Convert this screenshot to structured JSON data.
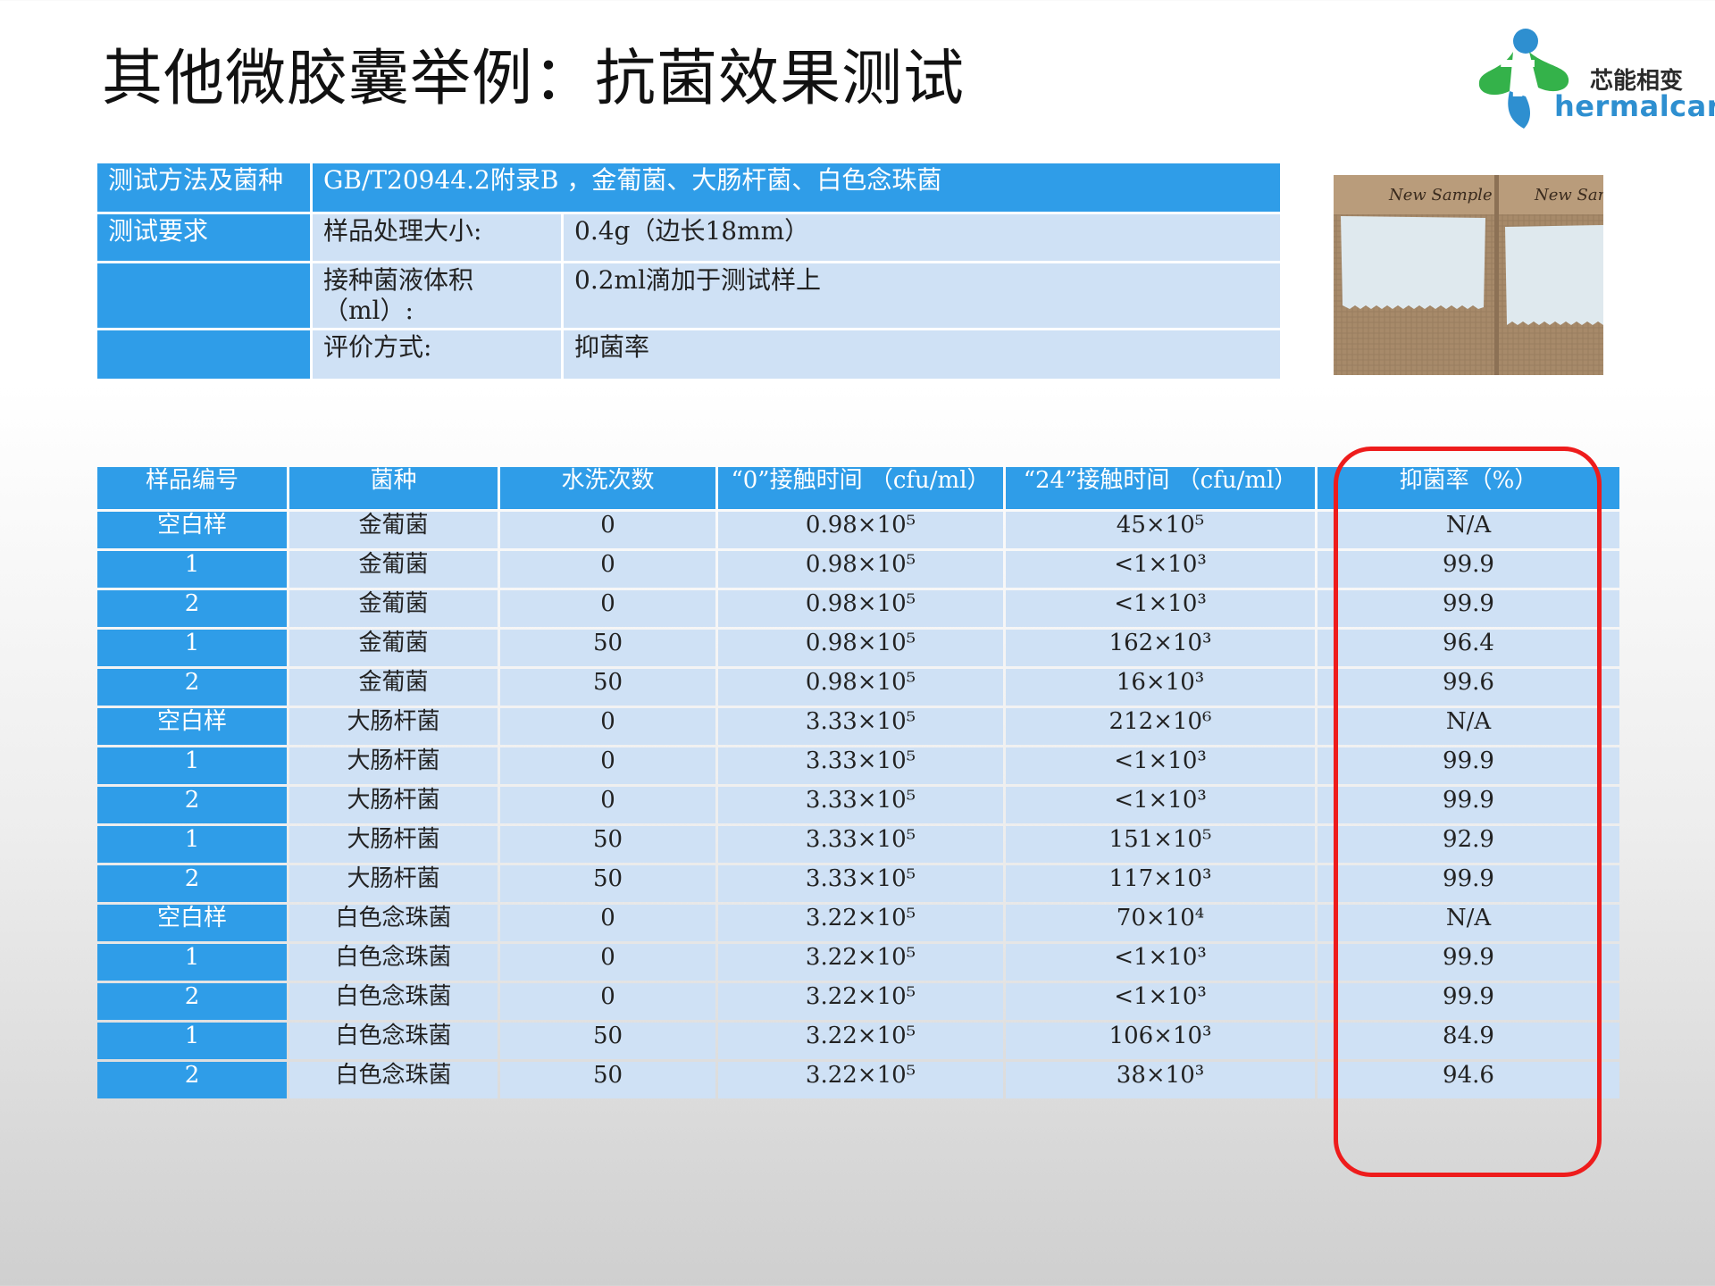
{
  "title": "其他微胶囊举例：抗菌效果测试",
  "logo": {
    "cn": "芯能相变",
    "en": "hermalcare",
    "letter": "T"
  },
  "method": {
    "row1": {
      "label": "测试方法及菌种",
      "value": "GB/T20944.2附录B ，金葡菌、大肠杆菌、白色念珠菌"
    },
    "row2": {
      "label": "测试要求",
      "key": "样品处理大小:",
      "value": "0.4g（边长18mm）"
    },
    "row3": {
      "key": "接种菌液体积（ml）:",
      "value": "0.2ml滴加于测试样上"
    },
    "row4": {
      "key": "评价方式:",
      "value": "抑菌率"
    }
  },
  "photo": {
    "label": "New Sample"
  },
  "results": {
    "headers": [
      "样品编号",
      "菌种",
      "水洗次数",
      "“0”接触时间 （cfu/ml）",
      "“24”接触时间 （cfu/ml）",
      "抑菌率（%）"
    ],
    "rows": [
      [
        "空白样",
        "金葡菌",
        "0",
        "0.98×10⁵",
        "45×10⁵",
        "N/A"
      ],
      [
        "1",
        "金葡菌",
        "0",
        "0.98×10⁵",
        "<1×10³",
        "99.9"
      ],
      [
        "2",
        "金葡菌",
        "0",
        "0.98×10⁵",
        "<1×10³",
        "99.9"
      ],
      [
        "1",
        "金葡菌",
        "50",
        "0.98×10⁵",
        "162×10³",
        "96.4"
      ],
      [
        "2",
        "金葡菌",
        "50",
        "0.98×10⁵",
        "16×10³",
        "99.6"
      ],
      [
        "空白样",
        "大肠杆菌",
        "0",
        "3.33×10⁵",
        "212×10⁶",
        "N/A"
      ],
      [
        "1",
        "大肠杆菌",
        "0",
        "3.33×10⁵",
        "<1×10³",
        "99.9"
      ],
      [
        "2",
        "大肠杆菌",
        "0",
        "3.33×10⁵",
        "<1×10³",
        "99.9"
      ],
      [
        "1",
        "大肠杆菌",
        "50",
        "3.33×10⁵",
        "151×10⁵",
        "92.9"
      ],
      [
        "2",
        "大肠杆菌",
        "50",
        "3.33×10⁵",
        "117×10³",
        "99.9"
      ],
      [
        "空白样",
        "白色念珠菌",
        "0",
        "3.22×10⁵",
        "70×10⁴",
        "N/A"
      ],
      [
        "1",
        "白色念珠菌",
        "0",
        "3.22×10⁵",
        "<1×10³",
        "99.9"
      ],
      [
        "2",
        "白色念珠菌",
        "0",
        "3.22×10⁵",
        "<1×10³",
        "99.9"
      ],
      [
        "1",
        "白色念珠菌",
        "50",
        "3.22×10⁵",
        "106×10³",
        "84.9"
      ],
      [
        "2",
        "白色念珠菌",
        "50",
        "3.22×10⁵",
        "38×10³",
        "94.6"
      ]
    ]
  },
  "colors": {
    "header_blue": "#2f9de8",
    "cell_blue": "#cfe1f5",
    "highlight_red": "#ee1c1c"
  }
}
